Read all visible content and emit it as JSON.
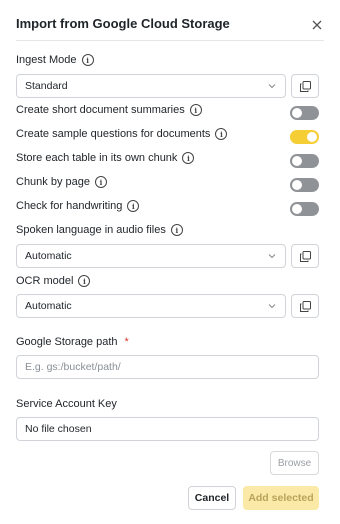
{
  "dialog": {
    "title": "Import from Google Cloud Storage",
    "close_icon": "close-icon"
  },
  "ingest_mode": {
    "label": "Ingest Mode",
    "value": "Standard"
  },
  "toggles": [
    {
      "label": "Create short document summaries",
      "on": false
    },
    {
      "label": "Create sample questions for documents",
      "on": true
    },
    {
      "label": "Store each table in its own chunk",
      "on": false
    },
    {
      "label": "Chunk by page",
      "on": false
    },
    {
      "label": "Check for handwriting",
      "on": false
    }
  ],
  "spoken_language": {
    "label": "Spoken language in audio files",
    "value": "Automatic"
  },
  "ocr_model": {
    "label": "OCR model",
    "value": "Automatic"
  },
  "storage_path": {
    "label": "Google Storage path",
    "required_mark": "*",
    "placeholder": "E.g. gs:/bucket/path/",
    "value": ""
  },
  "service_account": {
    "label": "Service Account Key",
    "file_status": "No file chosen",
    "browse_label": "Browse"
  },
  "footer": {
    "cancel_label": "Cancel",
    "add_label": "Add selected"
  },
  "colors": {
    "toggle_on": "#f5cd34",
    "toggle_off": "#8f9296",
    "add_button_bg": "#fbe9a8",
    "required": "#d63a2f"
  }
}
